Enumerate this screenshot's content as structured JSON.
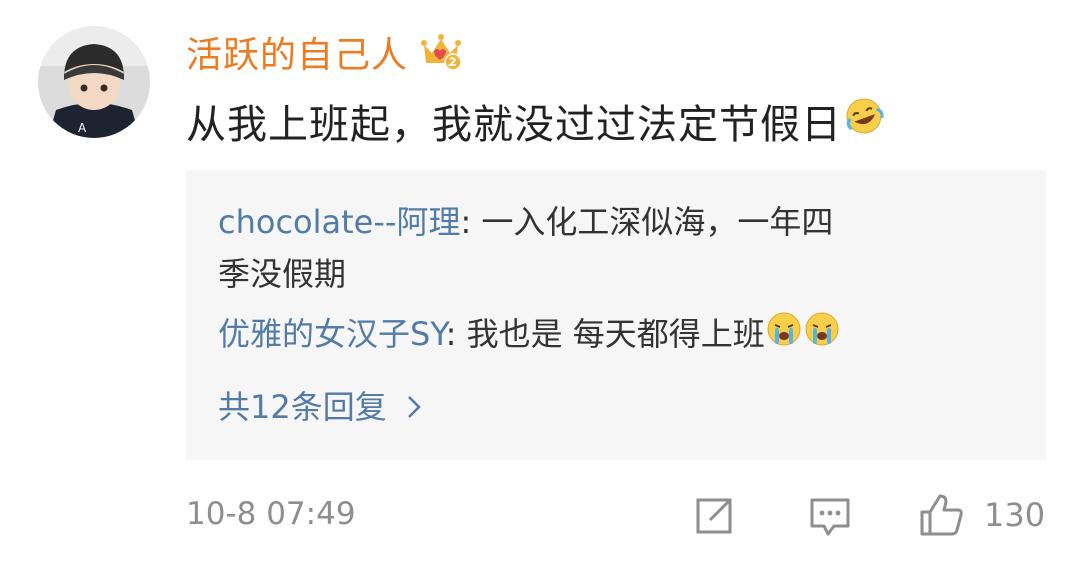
{
  "comment": {
    "username": "活跃的自己人",
    "text": "从我上班起，我就没过过法定节假日",
    "badge_icon": "crown-badge-icon",
    "emoji": "laughing-crying-emoji"
  },
  "replies": [
    {
      "name": "chocolate--阿理",
      "separator": ": ",
      "text": "一入化工深似海，一年四季没假期"
    },
    {
      "name": "优雅的女汉子SY",
      "separator": ": ",
      "text": "我也是  每天都得上班",
      "emoji": "crying-emoji"
    }
  ],
  "more_replies_label": "共12条回复",
  "footer": {
    "timestamp": "10-8 07:49",
    "like_count": "130"
  },
  "colors": {
    "username": "#ec7b22",
    "reply_name": "#527ba8",
    "reply_bg": "#f6f6f6",
    "meta_text": "#8e8e8e"
  }
}
